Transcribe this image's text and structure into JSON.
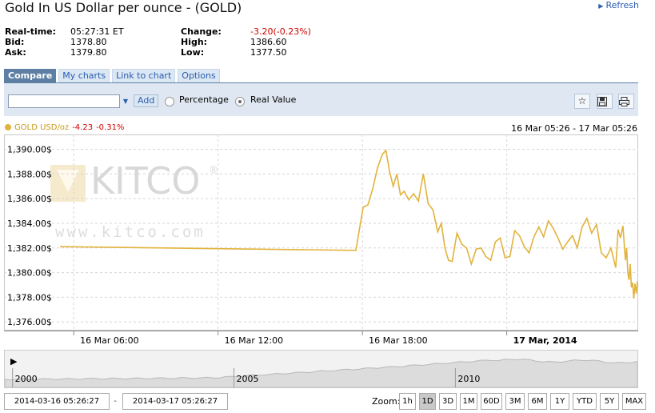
{
  "header": {
    "title": "Gold In US Dollar per ounce - (GOLD)",
    "refresh": "Refresh"
  },
  "quote": {
    "realtime_label": "Real-time:",
    "realtime_value": "05:27:31 ET",
    "bid_label": "Bid:",
    "bid_value": "1378.80",
    "ask_label": "Ask:",
    "ask_value": "1379.80",
    "change_label": "Change:",
    "change_value": "-3.20(-0.23%)",
    "high_label": "High:",
    "high_value": "1386.60",
    "low_label": "Low:",
    "low_value": "1377.50"
  },
  "tabs": [
    {
      "label": "Compare",
      "active": true
    },
    {
      "label": "My charts",
      "active": false
    },
    {
      "label": "Link to chart",
      "active": false
    },
    {
      "label": "Options",
      "active": false
    }
  ],
  "toolbar": {
    "add_label": "Add",
    "percentage_label": "Percentage",
    "real_value_label": "Real Value",
    "compare_input_value": ""
  },
  "legend": {
    "series_label": "GOLD USD/oz",
    "change": "-4.23",
    "change_pct": "-0.31%",
    "range": "16 Mar 05:26 - 17 Mar 05:26"
  },
  "watermark": {
    "brand": "KITCO",
    "url": "www.kitco.com"
  },
  "colors": {
    "series": "#e2b33c",
    "accent": "#5d7fa3",
    "negative": "#d00000"
  },
  "chart_data": {
    "type": "line",
    "y_ticks": [
      "1,390.00$",
      "1,388.00$",
      "1,386.00$",
      "1,384.00$",
      "1,382.00$",
      "1,380.00$",
      "1,378.00$",
      "1,376.00$"
    ],
    "y_tick_values": [
      1390,
      1388,
      1386,
      1384,
      1382,
      1380,
      1378,
      1376
    ],
    "ylim": [
      1375.3,
      1391.2
    ],
    "x_ticks": [
      "16 Mar 06:00",
      "16 Mar 12:00",
      "16 Mar 18:00",
      "17 Mar, 2014"
    ],
    "x_tick_hours": [
      0.57,
      6.57,
      12.57,
      18.57
    ],
    "xlim": [
      0,
      24
    ],
    "grid": true,
    "series": [
      {
        "name": "GOLD USD/oz",
        "x": [
          0,
          12.3,
          12.6,
          12.8,
          13.0,
          13.2,
          13.4,
          13.55,
          13.7,
          13.85,
          14.0,
          14.15,
          14.3,
          14.5,
          14.7,
          14.9,
          15.1,
          15.3,
          15.5,
          15.7,
          15.85,
          16.0,
          16.15,
          16.3,
          16.5,
          16.7,
          16.9,
          17.1,
          17.3,
          17.5,
          17.7,
          17.9,
          18.1,
          18.3,
          18.5,
          18.7,
          18.9,
          19.1,
          19.3,
          19.5,
          19.7,
          19.9,
          20.1,
          20.3,
          20.5,
          20.7,
          20.9,
          21.1,
          21.3,
          21.5,
          21.7,
          21.9,
          22.1,
          22.3,
          22.5,
          22.7,
          22.9,
          23.1,
          23.2,
          23.3,
          23.4,
          23.5,
          23.55,
          23.6,
          23.65,
          23.7,
          23.75,
          23.8,
          23.85,
          23.9,
          23.95,
          24.0
        ],
        "y": [
          1382.1,
          1381.8,
          1385.3,
          1385.5,
          1386.8,
          1388.5,
          1389.6,
          1389.9,
          1388.2,
          1387.0,
          1388.0,
          1386.3,
          1386.6,
          1385.9,
          1386.4,
          1385.8,
          1388.0,
          1385.6,
          1385.1,
          1383.3,
          1384.0,
          1382.0,
          1381.0,
          1380.9,
          1383.2,
          1382.3,
          1382.0,
          1380.7,
          1381.9,
          1382.0,
          1381.3,
          1381.0,
          1382.5,
          1382.8,
          1381.2,
          1381.3,
          1383.4,
          1383.0,
          1382.1,
          1381.6,
          1382.9,
          1383.7,
          1382.9,
          1384.2,
          1383.6,
          1382.8,
          1381.9,
          1382.5,
          1383.0,
          1382.0,
          1383.7,
          1384.4,
          1383.2,
          1383.9,
          1381.6,
          1381.2,
          1382.0,
          1380.4,
          1383.5,
          1382.8,
          1383.8,
          1381.0,
          1382.0,
          1380.0,
          1379.4,
          1380.7,
          1378.8,
          1379.2,
          1377.9,
          1379.1,
          1378.3,
          1379.3
        ]
      }
    ]
  },
  "navigator": {
    "x_labels": [
      "2000",
      "2005",
      "2010"
    ],
    "x_label_frac": [
      0.035,
      0.385,
      0.735
    ]
  },
  "bottom": {
    "start_date": "2014-03-16 05:26:27",
    "end_date": "2014-03-17 05:26:27",
    "dash": "-",
    "zoom_label": "Zoom:",
    "zoom_buttons": [
      {
        "label": "1h",
        "active": false
      },
      {
        "label": "1D",
        "active": true
      },
      {
        "label": "3D",
        "active": false
      },
      {
        "label": "1M",
        "active": false
      },
      {
        "label": "60D",
        "active": false
      },
      {
        "label": "3M",
        "active": false
      },
      {
        "label": "6M",
        "active": false
      },
      {
        "label": "1Y",
        "active": false
      },
      {
        "label": "YTD",
        "active": false
      },
      {
        "label": "5Y",
        "active": false
      },
      {
        "label": "MAX",
        "active": false
      }
    ]
  }
}
